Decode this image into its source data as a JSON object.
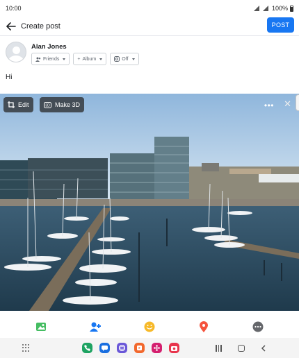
{
  "status_bar": {
    "time": "10:00",
    "battery": "100%"
  },
  "header": {
    "title": "Create post",
    "post_label": "POST"
  },
  "author": {
    "name": "Alan Jones",
    "audience_label": "Friends",
    "album_label": "Album",
    "instagram_label": "Off"
  },
  "post_text": "Hi",
  "photo": {
    "edit_label": "Edit",
    "make3d_label": "Make 3D"
  },
  "toolbar": {
    "icons": [
      "photo-video-icon",
      "tag-people-icon",
      "feeling-icon",
      "check-in-icon",
      "more-icon"
    ]
  },
  "colors": {
    "accent": "#1877f2",
    "photo_icon": "#45bd62",
    "tag_icon": "#1877f2",
    "feeling_icon": "#f7b928",
    "checkin_icon": "#f5533d",
    "more_icon": "#65676b"
  }
}
